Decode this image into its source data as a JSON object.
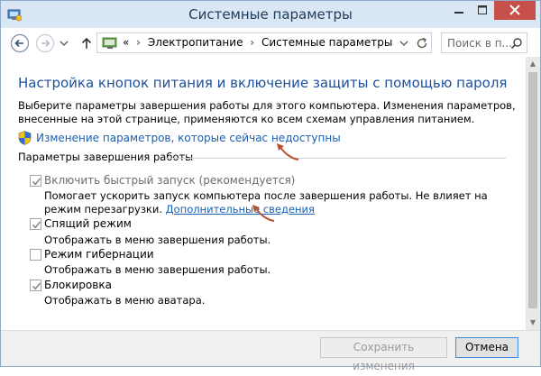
{
  "window": {
    "title": "Системные параметры",
    "minimize_icon": "minimize-icon",
    "maximize_icon": "maximize-icon",
    "close_icon": "close-icon"
  },
  "navigation": {
    "back_icon": "back-arrow-icon",
    "forward_icon": "forward-arrow-icon",
    "up_icon": "up-arrow-icon",
    "address": {
      "prefix": "«",
      "crumbs": [
        "Электропитание",
        "Системные параметры"
      ],
      "separator": "›"
    },
    "search_placeholder": "Поиск в п..."
  },
  "content": {
    "heading": "Настройка кнопок питания и включение защиты с помощью пароля",
    "description": "Выберите параметры завершения работы для этого компьютера. Изменения параметров, внесенные на этой странице, применяются ко всем схемам управления питанием.",
    "admin_link": "Изменение параметров, которые сейчас недоступны",
    "group_title": "Параметры завершения работы",
    "options": [
      {
        "label": "Включить быстрый запуск (рекомендуется)",
        "checked": true,
        "enabled": false,
        "description": "Помогает ускорить запуск компьютера после завершения работы. Не влияет на режим перезагрузки.",
        "link": "Дополнительные сведения"
      },
      {
        "label": "Спящий режим",
        "checked": true,
        "enabled": false,
        "description": "Отображать в меню завершения работы."
      },
      {
        "label": "Режим гибернации",
        "checked": false,
        "enabled": false,
        "description": "Отображать в меню завершения работы."
      },
      {
        "label": "Блокировка",
        "checked": true,
        "enabled": false,
        "description": "Отображать в меню аватара."
      }
    ]
  },
  "footer": {
    "save_label": "Сохранить изменения",
    "cancel_label": "Отмена"
  },
  "colors": {
    "heading": "#1c4f9c",
    "link": "#1a5fb4",
    "close_button": "#c7504a",
    "annotation_arrow": "#b5522f"
  }
}
